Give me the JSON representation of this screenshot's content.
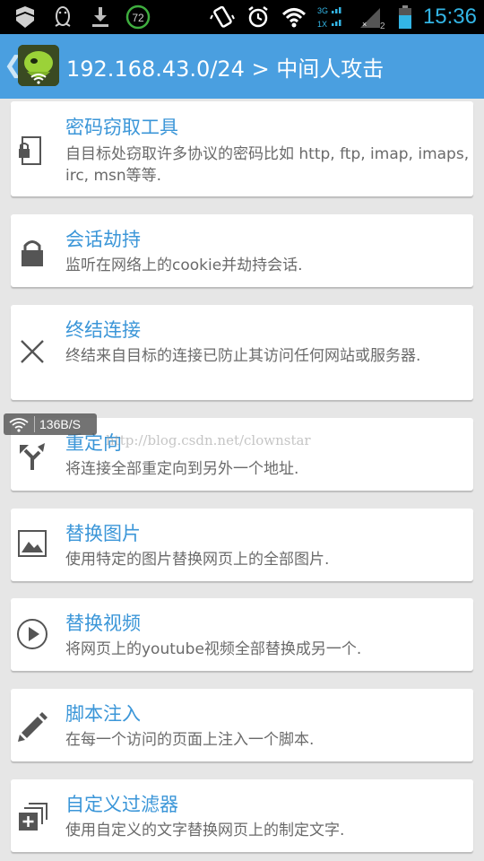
{
  "status_bar": {
    "badge_count": "72",
    "sim_badge": "2",
    "network_type": "3G",
    "network_type2": "1X",
    "time": "15:36",
    "icons": [
      "shield-icon",
      "penguin-icon",
      "download-icon",
      "vibrate-icon",
      "alarm-icon",
      "wifi-icon",
      "signal-icon",
      "battery-icon"
    ],
    "time_color": "#33b5e5"
  },
  "action_bar": {
    "back_glyph": "❮",
    "title": "192.168.43.0/24 > 中间人攻击",
    "background": "#4a9fe0"
  },
  "items": [
    {
      "title": "密码窃取工具",
      "description": "自目标处窃取许多协议的密码比如 http, ftp, imap, imaps, irc, msn等等.",
      "icon": "phone-lock-icon"
    },
    {
      "title": "会话劫持",
      "description": "监听在网络上的cookie并劫持会话.",
      "icon": "lock-icon"
    },
    {
      "title": "终结连接",
      "description": "终结来自目标的连接已防止其访问任何网站或服务器.",
      "icon": "close-icon"
    },
    {
      "title": "重定向",
      "description": "将连接全部重定向到另外一个地址.",
      "icon": "redirect-icon"
    },
    {
      "title": "替换图片",
      "description": "使用特定的图片替换网页上的全部图片.",
      "icon": "image-icon"
    },
    {
      "title": "替换视频",
      "description": "将网页上的youtube视频全部替换成另一个.",
      "icon": "play-icon"
    },
    {
      "title": "脚本注入",
      "description": "在每一个访问的页面上注入一个脚本.",
      "icon": "pencil-icon"
    },
    {
      "title": "自定义过滤器",
      "description": "使用自定义的文字替换网页上的制定文字.",
      "icon": "add-filter-icon"
    }
  ],
  "overlay": {
    "speed": "136B/S",
    "watermark": "http://blog.csdn.net/clownstar"
  },
  "colors": {
    "title": "#3b96d8",
    "description": "#6a6a6a",
    "background": "#e6e6e6"
  }
}
